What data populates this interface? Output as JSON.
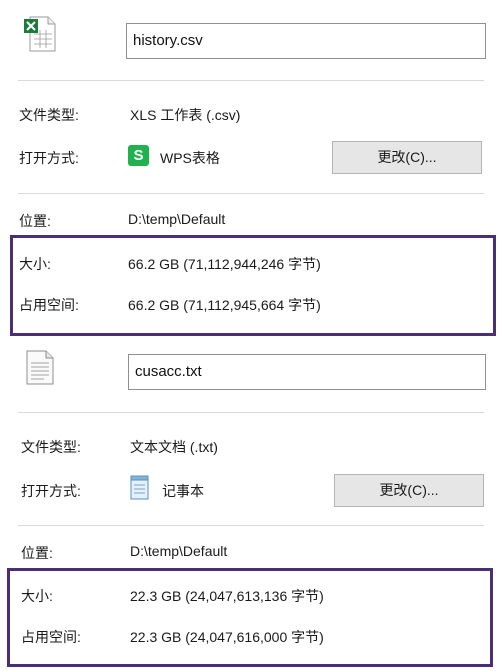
{
  "top": {
    "file_name": "history.csv",
    "file_type_label": "文件类型:",
    "file_type_value": "XLS 工作表 (.csv)",
    "open_with_label": "打开方式:",
    "open_with_app": "WPS表格",
    "app_icon_letter": "S",
    "change_button": "更改(C)...",
    "location_label": "位置:",
    "location_value": "D:\\temp\\Default",
    "size_label": "大小:",
    "size_value": "66.2 GB (71,112,944,246 字节)",
    "disk_size_label": "占用空间:",
    "disk_size_value": "66.2 GB (71,112,945,664 字节)"
  },
  "bottom": {
    "file_name": "cusacc.txt",
    "file_type_label": "文件类型:",
    "file_type_value": "文本文档 (.txt)",
    "open_with_label": "打开方式:",
    "open_with_app": "记事本",
    "change_button": "更改(C)...",
    "location_label": "位置:",
    "location_value": "D:\\temp\\Default",
    "size_label": "大小:",
    "size_value": "22.3 GB (24,047,613,136 字节)",
    "disk_size_label": "占用空间:",
    "disk_size_value": "22.3 GB (24,047,616,000 字节)"
  },
  "colors": {
    "highlight_border": "#4b2f74",
    "wps_green": "#21b14e",
    "excel_green": "#1e7a3c"
  },
  "icons": {
    "excel_file": "excel-file-icon",
    "wps_spreadsheet": "wps-spreadsheet-icon",
    "text_file": "text-file-icon",
    "notepad": "notepad-icon"
  }
}
